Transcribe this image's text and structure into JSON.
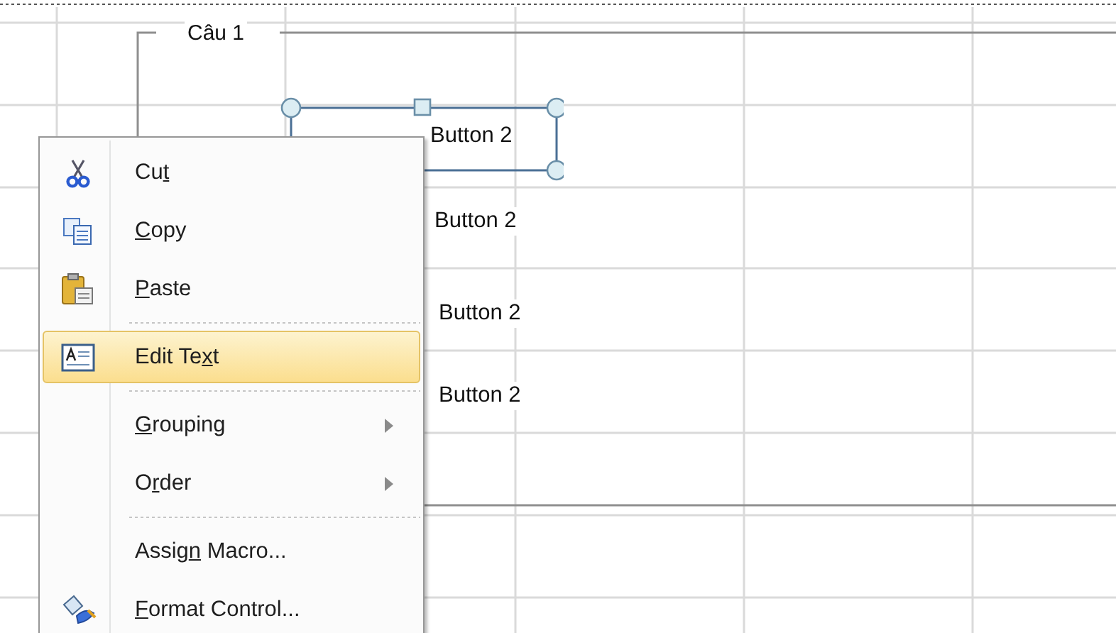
{
  "sheet": {
    "group_box": {
      "title": "Câu 1"
    },
    "option_buttons": [
      {
        "label": "Button 2",
        "selected": true
      },
      {
        "label": "Button 2",
        "selected": false
      },
      {
        "label": "Button 2",
        "selected": false
      },
      {
        "label": "Button 2",
        "selected": false
      }
    ]
  },
  "context_menu": {
    "items": [
      {
        "kind": "command",
        "label": {
          "before": "Cu",
          "underlined": "t"
        },
        "selected": false,
        "separator_before": false
      },
      {
        "kind": "command",
        "label": {
          "underlined": "C",
          "after": "opy"
        },
        "selected": false,
        "separator_before": false
      },
      {
        "kind": "command",
        "label": {
          "underlined": "P",
          "after": "aste"
        },
        "selected": false,
        "separator_before": false
      },
      {
        "kind": "command",
        "label": {
          "before": "Edit Te",
          "underlined": "x",
          "after": "t"
        },
        "selected": true,
        "separator_before": true
      },
      {
        "kind": "submenu",
        "label": {
          "underlined": "G",
          "after": "rouping"
        },
        "selected": false,
        "separator_before": true
      },
      {
        "kind": "submenu",
        "label": {
          "before": "O",
          "underlined": "r",
          "after": "der"
        },
        "selected": false,
        "separator_before": false
      },
      {
        "kind": "command",
        "label": {
          "before": "Assig",
          "underlined": "n",
          "after": " Macro..."
        },
        "selected": false,
        "separator_before": true
      },
      {
        "kind": "command",
        "label": {
          "underlined": "F",
          "after": "ormat Control..."
        },
        "selected": false,
        "separator_before": false
      }
    ]
  }
}
